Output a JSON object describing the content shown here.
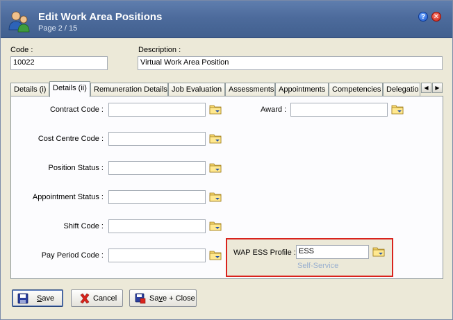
{
  "window": {
    "title": "Edit Work Area Positions",
    "subtitle": "Page 2 / 15",
    "help_label": "?",
    "close_label": "✕"
  },
  "header": {
    "code_label": "Code :",
    "code_value": "10022",
    "description_label": "Description :",
    "description_value": "Virtual Work Area Position"
  },
  "tabs": [
    {
      "label": "Details (i)",
      "active": false
    },
    {
      "label": "Details (ii)",
      "active": true
    },
    {
      "label": "Remuneration Details",
      "active": false
    },
    {
      "label": "Job Evaluation",
      "active": false
    },
    {
      "label": "Assessments",
      "active": false
    },
    {
      "label": "Appointments",
      "active": false
    },
    {
      "label": "Competencies",
      "active": false
    },
    {
      "label": "Delegatio",
      "active": false
    }
  ],
  "tab_scroll": {
    "left": "◀",
    "right": "▶"
  },
  "fields_left": [
    {
      "label": "Contract Code :",
      "value": ""
    },
    {
      "label": "Cost Centre Code :",
      "value": ""
    },
    {
      "label": "Position Status :",
      "value": ""
    },
    {
      "label": "Appointment Status :",
      "value": ""
    },
    {
      "label": "Shift Code :",
      "value": ""
    },
    {
      "label": "Pay Period Code :",
      "value": ""
    }
  ],
  "award": {
    "label": "Award :",
    "value": ""
  },
  "ess": {
    "label": "WAP ESS Profile :",
    "value": "ESS",
    "description": "Self-Service",
    "highlight_color": "#d9231d"
  },
  "buttons": {
    "save": {
      "pre": "",
      "accel": "S",
      "post": "ave"
    },
    "cancel": {
      "label": "Cancel"
    },
    "save_close": {
      "pre": "Sa",
      "accel": "v",
      "post": "e + Close"
    }
  },
  "icons": {
    "title": "users-icon",
    "lookup": "folder-lookup-icon",
    "save": "floppy-disk-icon",
    "cancel": "red-x-icon",
    "save_close": "floppy-close-icon"
  }
}
